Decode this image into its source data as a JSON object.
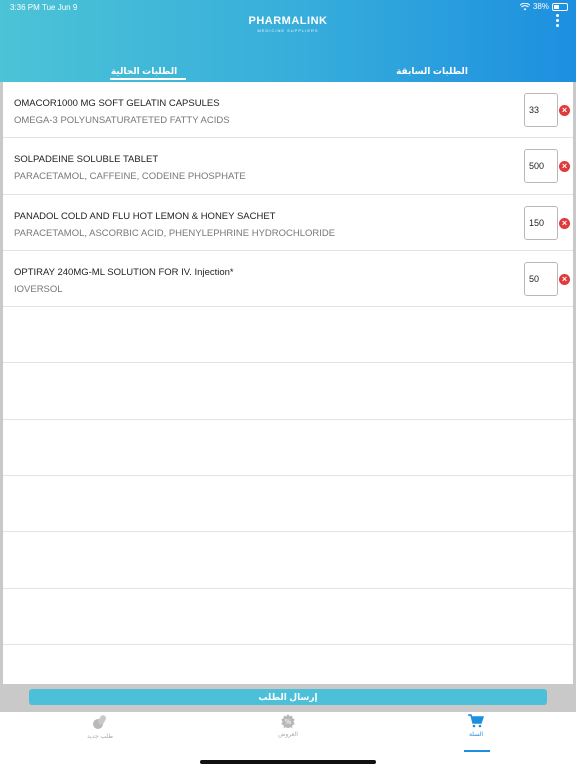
{
  "status_bar": {
    "time": "3:36 PM",
    "date": "Tue Jun 9",
    "battery": "38%"
  },
  "header": {
    "logo": "PHARMALINK",
    "logo_sub": "MEDICINE SUPPLIERS"
  },
  "tabs": {
    "previous": "الطلبات السابقة",
    "current": "الطلبات الحالية"
  },
  "items": [
    {
      "name": "OMACOR1000 MG SOFT GELATIN CAPSULES",
      "ingredients": "OMEGA-3 POLYUNSATURATETED FATTY ACIDS",
      "qty": "33"
    },
    {
      "name": "SOLPADEINE SOLUBLE TABLET",
      "ingredients": "PARACETAMOL, CAFFEINE, CODEINE PHOSPHATE",
      "qty": "500"
    },
    {
      "name": "PANADOL COLD AND FLU HOT LEMON & HONEY SACHET",
      "ingredients": "PARACETAMOL, ASCORBIC ACID, PHENYLEPHRINE HYDROCHLORIDE",
      "qty": "150"
    },
    {
      "name": "OPTIRAY 240MG-ML SOLUTION FOR IV. Injection*",
      "ingredients": "IOVERSOL",
      "qty": "50"
    }
  ],
  "submit_label": "إرسال الطلب",
  "tabbar": {
    "new_order": "طلب جديد",
    "offers": "العروض",
    "cart": "السلة"
  },
  "colors": {
    "accent": "#1d8fe0",
    "header_start": "#4cc3d6",
    "remove": "#e03a3a"
  },
  "icons": {
    "remove": "close-circle-icon",
    "cart": "cart-icon",
    "offers": "offer-badge-icon",
    "new_order": "pills-icon",
    "menu": "more-vertical-icon"
  }
}
